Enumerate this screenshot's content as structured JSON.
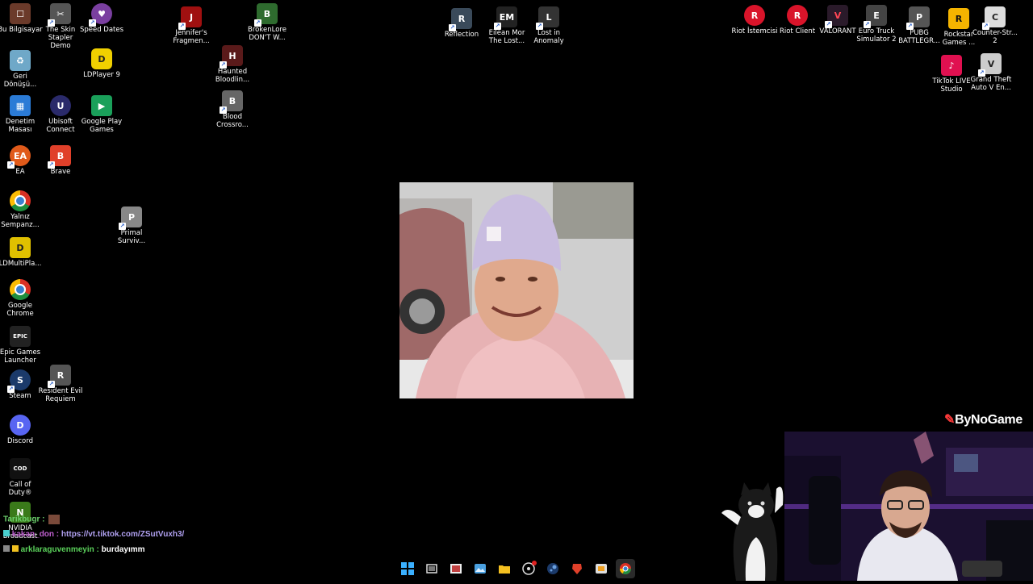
{
  "desktop": {
    "icons": [
      {
        "label": "Bu Bilgisayar",
        "color": "#6b3a2a",
        "glyph": "☐"
      },
      {
        "label": "The Skin Stapler Demo",
        "color": "#555",
        "glyph": "✂"
      },
      {
        "label": "Speed Dates",
        "color": "#7a3fa0",
        "glyph": "♥"
      },
      {
        "label": "Jennifer's Fragmen...",
        "color": "#a01010",
        "glyph": "J"
      },
      {
        "label": "BrokenLore DON'T W...",
        "color": "#2e6b2e",
        "glyph": "B"
      },
      {
        "label": "Reflection",
        "color": "#3a4a5a",
        "glyph": "R"
      },
      {
        "label": "Eilean Mor The Lost...",
        "color": "#222",
        "glyph": "EM"
      },
      {
        "label": "Lost in Anomaly",
        "color": "#333",
        "glyph": "L"
      },
      {
        "label": "Riot İstemcisi",
        "color": "#d9142a",
        "glyph": "R"
      },
      {
        "label": "Riot Client",
        "color": "#d9142a",
        "glyph": "R"
      },
      {
        "label": "VALORANT",
        "color": "#2a1a2a",
        "glyph": "V"
      },
      {
        "label": "Euro Truck Simulator 2",
        "color": "#444",
        "glyph": "E"
      },
      {
        "label": "PUBG BATTLEGR...",
        "color": "#555",
        "glyph": "P"
      },
      {
        "label": "Rockstar Games ...",
        "color": "#f4b400",
        "glyph": "R"
      },
      {
        "label": "Counter-Str... 2",
        "color": "#ddd",
        "glyph": "C"
      },
      {
        "label": "Geri Dönüşü...",
        "color": "#6fa8c8",
        "glyph": "♻"
      },
      {
        "label": "LDPlayer 9",
        "color": "#f0d000",
        "glyph": "D"
      },
      {
        "label": "Haunted Bloodlin...",
        "color": "#5a1a1a",
        "glyph": "H"
      },
      {
        "label": "TikTok LIVE Studio",
        "color": "#e01050",
        "glyph": "♪"
      },
      {
        "label": "Grand Theft Auto V En...",
        "color": "#ccc",
        "glyph": "V"
      },
      {
        "label": "Denetim Masası",
        "color": "#2b7bd6",
        "glyph": "▦"
      },
      {
        "label": "Ubisoft Connect",
        "color": "#2a2a6a",
        "glyph": "U"
      },
      {
        "label": "Google Play Games",
        "color": "#1aa05a",
        "glyph": "▶"
      },
      {
        "label": "Blood Crossro...",
        "color": "#666",
        "glyph": "B"
      },
      {
        "label": "EA",
        "color": "#e05a1a",
        "glyph": "EA"
      },
      {
        "label": "Brave",
        "color": "#e0402a",
        "glyph": "B"
      },
      {
        "label": "Yalnız Sempanz...",
        "color": "#3a80d0",
        "glyph": "●"
      },
      {
        "label": "Primal Surviv...",
        "color": "#888",
        "glyph": "P"
      },
      {
        "label": "LDMultiPla...",
        "color": "#e0c000",
        "glyph": "D"
      },
      {
        "label": "Google Chrome",
        "color": "#3a80d0",
        "glyph": "●"
      },
      {
        "label": "Epic Games Launcher",
        "color": "#222",
        "glyph": "EPIC"
      },
      {
        "label": "Steam",
        "color": "#1b3a6a",
        "glyph": "S"
      },
      {
        "label": "Resident Evil Requiem",
        "color": "#555",
        "glyph": "R"
      },
      {
        "label": "Discord",
        "color": "#5865f2",
        "glyph": "D"
      },
      {
        "label": "Call of Duty®",
        "color": "#111",
        "glyph": "COD"
      },
      {
        "label": "NVIDIA Broadcast",
        "color": "#3a7a1a",
        "glyph": "N"
      }
    ]
  },
  "overlay": {
    "brand": "ByNoGame",
    "chat": [
      {
        "user": "Tarikbugr :",
        "message": "",
        "user_color": "#6cd06c"
      },
      {
        "user": "kakan_don :",
        "message": "https://vt.tiktok.com/ZSutVuxh3/",
        "user_color": "#c060d0",
        "message_color": "#b0a0f0"
      },
      {
        "user": "arklaraguvenmeyin :",
        "message": "burdayımm",
        "user_color": "#5ad05a",
        "message_color": "#fff"
      }
    ]
  },
  "taskbar": {
    "items": [
      {
        "name": "start-icon",
        "color": "#3ab0ff"
      },
      {
        "name": "task-view-icon",
        "color": "#ddd"
      },
      {
        "name": "snipping-tool-icon",
        "color": "#ccc"
      },
      {
        "name": "photos-icon",
        "color": "#4aa0e0"
      },
      {
        "name": "file-explorer-icon",
        "color": "#f4c020"
      },
      {
        "name": "obs-icon",
        "color": "#ddd"
      },
      {
        "name": "steam-taskbar-icon",
        "color": "#6aa0e0"
      },
      {
        "name": "brave-taskbar-icon",
        "color": "#e0402a"
      },
      {
        "name": "app-taskbar-icon",
        "color": "#f0a020"
      },
      {
        "name": "chrome-taskbar-icon",
        "color": "#3a80d0"
      }
    ]
  }
}
